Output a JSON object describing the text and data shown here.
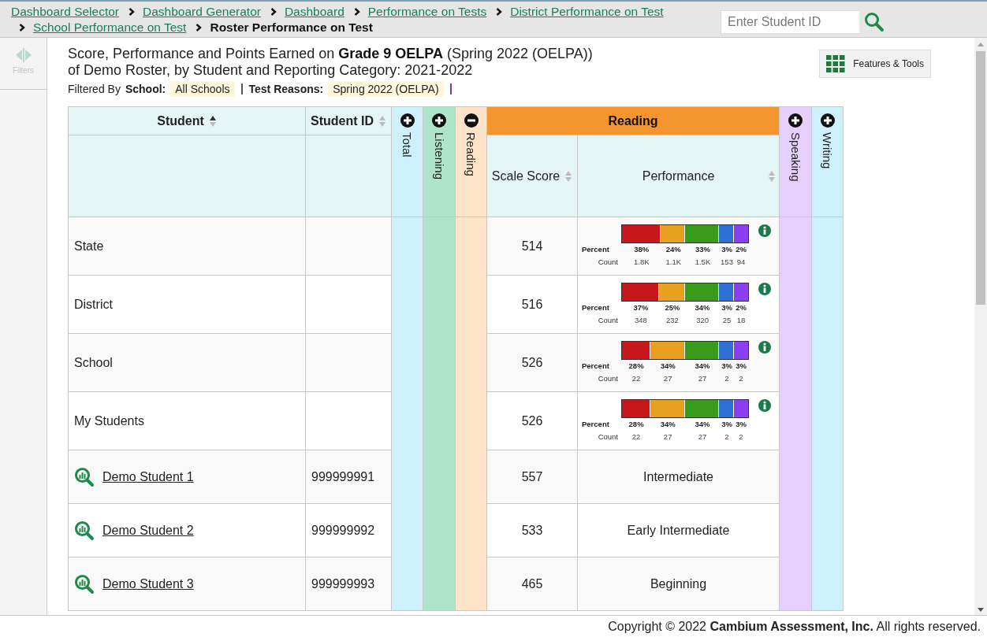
{
  "breadcrumbs": [
    {
      "kind": "link",
      "label": "Dashboard Selector"
    },
    {
      "kind": "link",
      "label": "Dashboard Generator"
    },
    {
      "kind": "link",
      "label": "Dashboard"
    },
    {
      "kind": "link",
      "label": "Performance on Tests"
    },
    {
      "kind": "link",
      "label": "District Performance on Test"
    },
    {
      "kind": "link",
      "label": "School Performance on Test"
    },
    {
      "kind": "current",
      "label": "Roster Performance on Test"
    }
  ],
  "search": {
    "placeholder": "Enter Student ID"
  },
  "filters_button": {
    "label": "Filters",
    "disabled": true
  },
  "report_title": "Score, Performance and Points Earned on **Grade 9 OELPA** (Spring 2022 (OELPA)) of Demo Roster, by Student and Reporting Category: 2021-2022",
  "filter_bar": {
    "label": "Filtered By",
    "items": [
      {
        "kind": "filter",
        "name": "School:",
        "value": "All Schools"
      },
      {
        "kind": "separator",
        "color": "#555555"
      },
      {
        "kind": "filter",
        "name": "Test Reasons:",
        "value": "Spring 2022 (OELPA)"
      },
      {
        "kind": "separator",
        "color": "#8b2f9b"
      }
    ]
  },
  "features_button": {
    "label": "Features & Tools"
  },
  "table": {
    "columns": [
      {
        "kind": "sortable",
        "label": "Student",
        "sorted": true
      },
      {
        "kind": "sortable",
        "label": "Student ID",
        "sorted": false
      },
      {
        "kind": "group",
        "label": "Total",
        "expanded": false,
        "color": "#cdf0fc"
      },
      {
        "kind": "group",
        "label": "Listening",
        "expanded": false,
        "color": "#aee4c9"
      },
      {
        "kind": "group",
        "label": "Reading",
        "expanded": true,
        "color": "#fde3c8",
        "group_label": "Reading",
        "subcolumns": [
          {
            "label": "Scale Score",
            "sorted": false
          },
          {
            "label": "Performance",
            "sorted": false
          }
        ]
      },
      {
        "kind": "group",
        "label": "Speaking",
        "expanded": false,
        "color": "#e6cffa"
      },
      {
        "kind": "group",
        "label": "Writing",
        "expanded": false,
        "color": "#cdf0fc"
      }
    ],
    "rows": [
      {
        "kind": "aggregate",
        "name": "State",
        "score": "514",
        "performance": {
          "percent_label": "Percent",
          "count_label": "Count",
          "segments": [
            {
              "percent": "38%",
              "count": "1.8K",
              "color": "#c8161d"
            },
            {
              "percent": "24%",
              "count": "1.1K",
              "color": "#e8a020"
            },
            {
              "percent": "33%",
              "count": "1.5K",
              "color": "#3a9a1c"
            },
            {
              "percent": "3%",
              "count": "153",
              "color": "#2f6fd6"
            },
            {
              "percent": "2%",
              "count": "94",
              "color": "#8a3ff0"
            }
          ]
        }
      },
      {
        "kind": "aggregate",
        "name": "District",
        "score": "516",
        "performance": {
          "percent_label": "Percent",
          "count_label": "Count",
          "segments": [
            {
              "percent": "37%",
              "count": "348",
              "color": "#c8161d"
            },
            {
              "percent": "25%",
              "count": "232",
              "color": "#e8a020"
            },
            {
              "percent": "34%",
              "count": "320",
              "color": "#3a9a1c"
            },
            {
              "percent": "3%",
              "count": "25",
              "color": "#2f6fd6"
            },
            {
              "percent": "2%",
              "count": "18",
              "color": "#8a3ff0"
            }
          ]
        }
      },
      {
        "kind": "aggregate",
        "name": "School",
        "score": "526",
        "performance": {
          "percent_label": "Percent",
          "count_label": "Count",
          "segments": [
            {
              "percent": "28%",
              "count": "22",
              "color": "#c8161d"
            },
            {
              "percent": "34%",
              "count": "27",
              "color": "#e8a020"
            },
            {
              "percent": "34%",
              "count": "27",
              "color": "#3a9a1c"
            },
            {
              "percent": "3%",
              "count": "2",
              "color": "#2f6fd6"
            },
            {
              "percent": "3%",
              "count": "2",
              "color": "#8a3ff0"
            }
          ]
        }
      },
      {
        "kind": "aggregate",
        "name": "My Students",
        "score": "526",
        "performance": {
          "percent_label": "Percent",
          "count_label": "Count",
          "segments": [
            {
              "percent": "28%",
              "count": "22",
              "color": "#c8161d"
            },
            {
              "percent": "34%",
              "count": "27",
              "color": "#e8a020"
            },
            {
              "percent": "34%",
              "count": "27",
              "color": "#3a9a1c"
            },
            {
              "percent": "3%",
              "count": "2",
              "color": "#2f6fd6"
            },
            {
              "percent": "3%",
              "count": "2",
              "color": "#8a3ff0"
            }
          ]
        }
      },
      {
        "kind": "student",
        "name": "Demo Student 1",
        "id": "999999991",
        "score": "557",
        "level_text": "Intermediate"
      },
      {
        "kind": "student",
        "name": "Demo Student 2",
        "id": "999999992",
        "score": "533",
        "level_text": "Early Intermediate"
      },
      {
        "kind": "student",
        "name": "Demo Student 3",
        "id": "999999993",
        "score": "465",
        "level_text": "Beginning"
      }
    ]
  },
  "footer": "Copyright © 2022 **Cambium Assessment, Inc.** All rights reserved."
}
